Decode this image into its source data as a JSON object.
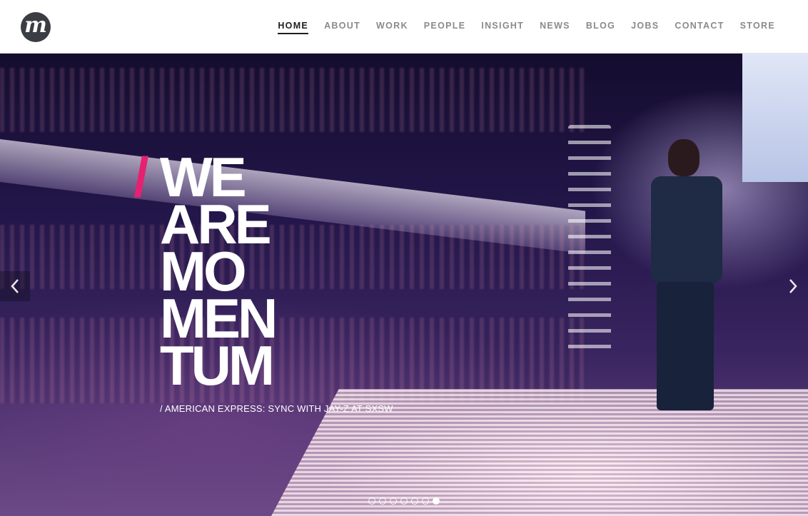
{
  "brand": {
    "logo_letter": "m"
  },
  "nav": {
    "items": [
      "HOME",
      "ABOUT",
      "WORK",
      "PEOPLE",
      "INSIGHT",
      "NEWS",
      "BLOG",
      "JOBS",
      "CONTACT",
      "STORE"
    ],
    "active": "HOME"
  },
  "hero": {
    "slash": "/",
    "headline_lines": [
      "WE",
      "ARE",
      "MO",
      "MEN",
      "TUM"
    ],
    "caption": "/ AMERICAN EXPRESS: SYNC WITH JAY-Z AT SXSW",
    "prev_icon": "chevron-left-icon",
    "next_icon": "chevron-right-icon",
    "slide_count": 7,
    "active_slide": 7
  },
  "colors": {
    "accent": "#e6216f",
    "nav_text": "#8a8a8a",
    "nav_active": "#1e1e1e",
    "logo_bg": "#3a3d44"
  }
}
